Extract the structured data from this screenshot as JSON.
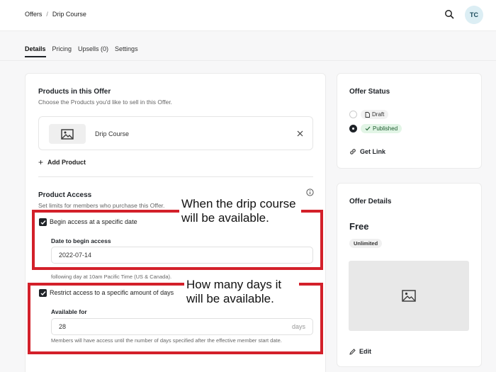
{
  "breadcrumb": {
    "root": "Offers",
    "current": "Drip Course"
  },
  "header": {
    "avatar_initials": "TC"
  },
  "tabs": [
    {
      "label": "Details",
      "active": true
    },
    {
      "label": "Pricing"
    },
    {
      "label": "Upsells (0)"
    },
    {
      "label": "Settings"
    }
  ],
  "products": {
    "title": "Products in this Offer",
    "subtitle": "Choose the Products you'd like to sell in this Offer.",
    "item_name": "Drip Course",
    "add_label": "Add Product"
  },
  "access": {
    "title": "Product Access",
    "subtitle": "Set limits for members who purchase this Offer.",
    "begin_label": "Begin access at a specific date",
    "date_label": "Date to begin access",
    "date_value": "2022-07-14",
    "note": "following day at 10am Pacific Time (US & Canada).",
    "restrict_label": "Restrict access to a specific amount of days",
    "days_label": "Available for",
    "days_value": "28",
    "days_unit": "days",
    "days_note": "Members will have access until the number of days specified after the effective member start date."
  },
  "annotations": {
    "first": "When the drip course will be available.",
    "second": "How many days it will be available."
  },
  "status": {
    "title": "Offer Status",
    "draft": "Draft",
    "published": "Published",
    "selected": "published",
    "get_link": "Get Link"
  },
  "details": {
    "title": "Offer Details",
    "price": "Free",
    "badge": "Unlimited",
    "edit": "Edit"
  },
  "colors": {
    "accent_red": "#d3202a",
    "published_green": "#e2f5e6"
  }
}
